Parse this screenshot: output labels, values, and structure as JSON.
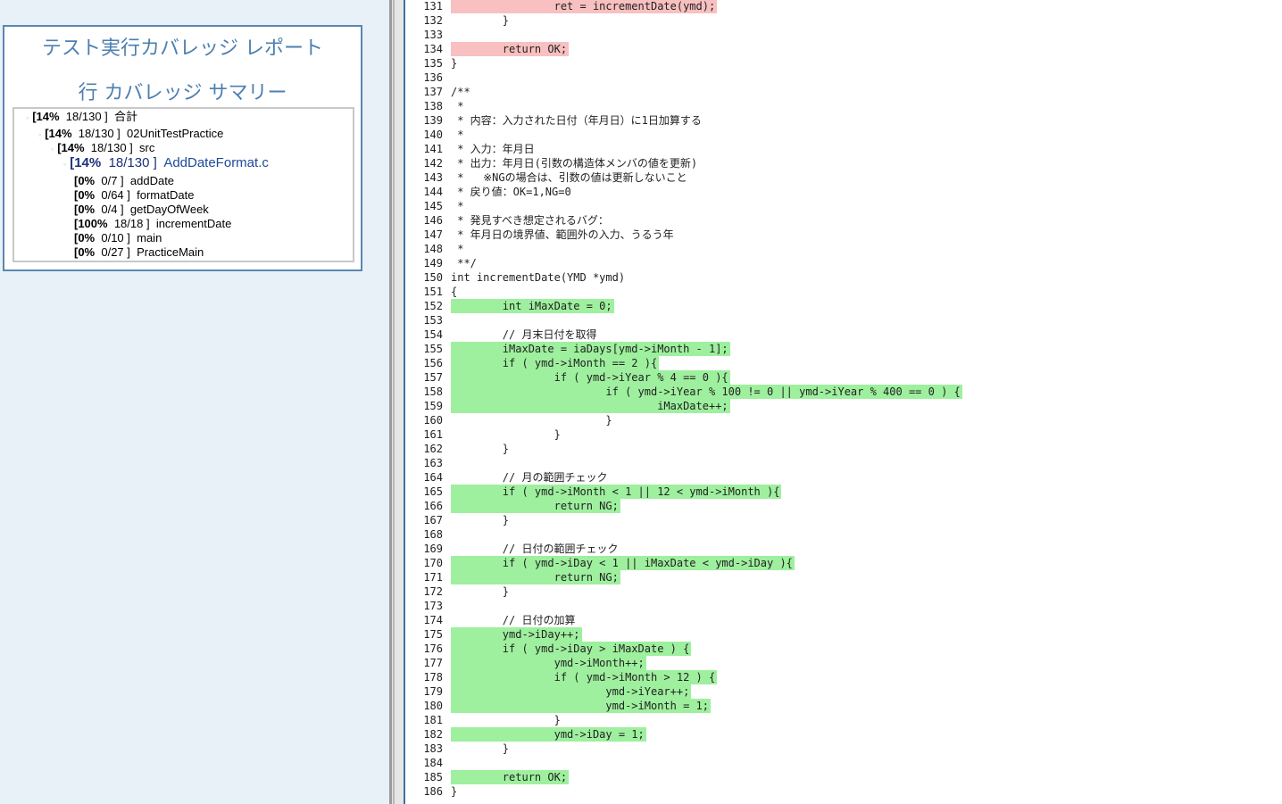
{
  "report": {
    "title": "テスト実行カバレッジ レポート",
    "summary_title": "行 カバレッジ サマリー"
  },
  "tree": [
    {
      "pct": "[14%",
      "ratio": "18/130 ]",
      "name": "合計",
      "indent": 0,
      "bullet": true
    },
    {
      "pct": "[14%",
      "ratio": "18/130 ]",
      "name": "02UnitTestPractice",
      "indent": 1,
      "bullet": true
    },
    {
      "pct": "[14%",
      "ratio": "18/130 ]",
      "name": "src",
      "indent": 2,
      "bullet": true
    },
    {
      "pct": "[14%",
      "ratio": "18/130 ]",
      "name": "AddDateFormat.c",
      "indent": 3,
      "bullet": true,
      "selected": true
    },
    {
      "pct": "[0%",
      "ratio": "0/7 ]",
      "name": "addDate",
      "indent": 4
    },
    {
      "pct": "[0%",
      "ratio": "0/64 ]",
      "name": "formatDate",
      "indent": 4
    },
    {
      "pct": "[0%",
      "ratio": "0/4 ]",
      "name": "getDayOfWeek",
      "indent": 4
    },
    {
      "pct": "[100%",
      "ratio": "18/18 ]",
      "name": "incrementDate",
      "indent": 4
    },
    {
      "pct": "[0%",
      "ratio": "0/10 ]",
      "name": "main",
      "indent": 4
    },
    {
      "pct": "[0%",
      "ratio": "0/27 ]",
      "name": "PracticeMain",
      "indent": 4
    }
  ],
  "code_lines": [
    {
      "n": "131",
      "text": "\t\tret = incrementDate(ymd);",
      "cov": "miss"
    },
    {
      "n": "132",
      "text": "\t}",
      "cov": ""
    },
    {
      "n": "133",
      "text": "",
      "cov": ""
    },
    {
      "n": "134",
      "text": "\treturn OK;",
      "cov": "miss"
    },
    {
      "n": "135",
      "text": "}",
      "cov": ""
    },
    {
      "n": "136",
      "text": "",
      "cov": ""
    },
    {
      "n": "137",
      "text": "/**",
      "cov": ""
    },
    {
      "n": "138",
      "text": " *",
      "cov": ""
    },
    {
      "n": "139",
      "text": " * 内容：入力された日付（年月日）に1日加算する",
      "cov": ""
    },
    {
      "n": "140",
      "text": " *",
      "cov": ""
    },
    {
      "n": "141",
      "text": " * 入力：年月日",
      "cov": ""
    },
    {
      "n": "142",
      "text": " * 出力：年月日(引数の構造体メンバの値を更新)",
      "cov": ""
    },
    {
      "n": "143",
      "text": " *   ※NGの場合は、引数の値は更新しないこと",
      "cov": ""
    },
    {
      "n": "144",
      "text": " * 戻り値：OK=1,NG=0",
      "cov": ""
    },
    {
      "n": "145",
      "text": " *",
      "cov": ""
    },
    {
      "n": "146",
      "text": " * 発見すべき想定されるバグ：",
      "cov": ""
    },
    {
      "n": "147",
      "text": " * 年月日の境界値、範囲外の入力、うるう年",
      "cov": ""
    },
    {
      "n": "148",
      "text": " *",
      "cov": ""
    },
    {
      "n": "149",
      "text": " **/",
      "cov": ""
    },
    {
      "n": "150",
      "text": "int incrementDate(YMD *ymd)",
      "cov": ""
    },
    {
      "n": "151",
      "text": "{",
      "cov": ""
    },
    {
      "n": "152",
      "text": "\tint iMaxDate = 0;",
      "cov": "hit"
    },
    {
      "n": "153",
      "text": "",
      "cov": ""
    },
    {
      "n": "154",
      "text": "\t// 月末日付を取得",
      "cov": ""
    },
    {
      "n": "155",
      "text": "\tiMaxDate = iaDays[ymd->iMonth - 1];",
      "cov": "hit"
    },
    {
      "n": "156",
      "text": "\tif ( ymd->iMonth == 2 ){",
      "cov": "hit"
    },
    {
      "n": "157",
      "text": "\t\tif ( ymd->iYear % 4 == 0 ){",
      "cov": "hit"
    },
    {
      "n": "158",
      "text": "\t\t\tif ( ymd->iYear % 100 != 0 || ymd->iYear % 400 == 0 ) {",
      "cov": "hit"
    },
    {
      "n": "159",
      "text": "\t\t\t\tiMaxDate++;",
      "cov": "hit"
    },
    {
      "n": "160",
      "text": "\t\t\t}",
      "cov": ""
    },
    {
      "n": "161",
      "text": "\t\t}",
      "cov": ""
    },
    {
      "n": "162",
      "text": "\t}",
      "cov": ""
    },
    {
      "n": "163",
      "text": "",
      "cov": ""
    },
    {
      "n": "164",
      "text": "\t// 月の範囲チェック",
      "cov": ""
    },
    {
      "n": "165",
      "text": "\tif ( ymd->iMonth < 1 || 12 < ymd->iMonth ){",
      "cov": "hit"
    },
    {
      "n": "166",
      "text": "\t\treturn NG;",
      "cov": "hit"
    },
    {
      "n": "167",
      "text": "\t}",
      "cov": ""
    },
    {
      "n": "168",
      "text": "",
      "cov": ""
    },
    {
      "n": "169",
      "text": "\t// 日付の範囲チェック",
      "cov": ""
    },
    {
      "n": "170",
      "text": "\tif ( ymd->iDay < 1 || iMaxDate < ymd->iDay ){",
      "cov": "hit"
    },
    {
      "n": "171",
      "text": "\t\treturn NG;",
      "cov": "hit"
    },
    {
      "n": "172",
      "text": "\t}",
      "cov": ""
    },
    {
      "n": "173",
      "text": "",
      "cov": ""
    },
    {
      "n": "174",
      "text": "\t// 日付の加算",
      "cov": ""
    },
    {
      "n": "175",
      "text": "\tymd->iDay++;",
      "cov": "hit"
    },
    {
      "n": "176",
      "text": "\tif ( ymd->iDay > iMaxDate ) {",
      "cov": "hit"
    },
    {
      "n": "177",
      "text": "\t\tymd->iMonth++;",
      "cov": "hit"
    },
    {
      "n": "178",
      "text": "\t\tif ( ymd->iMonth > 12 ) {",
      "cov": "hit"
    },
    {
      "n": "179",
      "text": "\t\t\tymd->iYear++;",
      "cov": "hit"
    },
    {
      "n": "180",
      "text": "\t\t\tymd->iMonth = 1;",
      "cov": "hit"
    },
    {
      "n": "181",
      "text": "\t\t}",
      "cov": ""
    },
    {
      "n": "182",
      "text": "\t\tymd->iDay = 1;",
      "cov": "hit"
    },
    {
      "n": "183",
      "text": "\t}",
      "cov": ""
    },
    {
      "n": "184",
      "text": "",
      "cov": ""
    },
    {
      "n": "185",
      "text": "\treturn OK;",
      "cov": "hit"
    },
    {
      "n": "186",
      "text": "}",
      "cov": ""
    }
  ],
  "colors": {
    "covered": "#9ef09e",
    "uncovered": "#f8c0c0",
    "title": "#4d7faf",
    "pane_background": "#e8f0f8"
  }
}
